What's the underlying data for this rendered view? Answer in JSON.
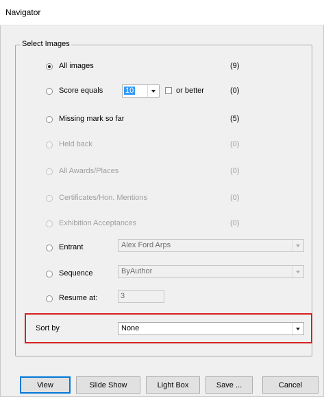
{
  "window": {
    "title": "Navigator"
  },
  "group": {
    "legend": "Select Images"
  },
  "options": {
    "all_images": {
      "label": "All images",
      "count": "(9)"
    },
    "score_equals": {
      "label": "Score equals",
      "score_value": "10",
      "or_better_label": "or better",
      "count": "(0)"
    },
    "missing_mark": {
      "label": "Missing mark so far",
      "count": "(5)"
    },
    "held_back": {
      "label": "Held back",
      "count": "(0)"
    },
    "awards": {
      "label": "All Awards/Places",
      "count": "(0)"
    },
    "certificates": {
      "label": "Certificates/Hon. Mentions",
      "count": "(0)"
    },
    "exhibition": {
      "label": "Exhibition Acceptances",
      "count": "(0)"
    },
    "entrant": {
      "label": "Entrant",
      "value": "Alex Ford Arps"
    },
    "sequence": {
      "label": "Sequence",
      "value": "ByAuthor"
    },
    "resume": {
      "label": "Resume at:",
      "value": "3"
    }
  },
  "sort": {
    "label": "Sort by",
    "value": "None"
  },
  "buttons": {
    "view": "View",
    "slide_show": "Slide Show",
    "light_box": "Light Box",
    "save": "Save ...",
    "cancel": "Cancel"
  },
  "colors": {
    "highlight": "#d62020",
    "selection": "#3399ff",
    "focus_border": "#0078d7"
  },
  "icons": [
    "radio-selected",
    "radio-unselected",
    "checkbox-unchecked",
    "dropdown-arrow"
  ]
}
